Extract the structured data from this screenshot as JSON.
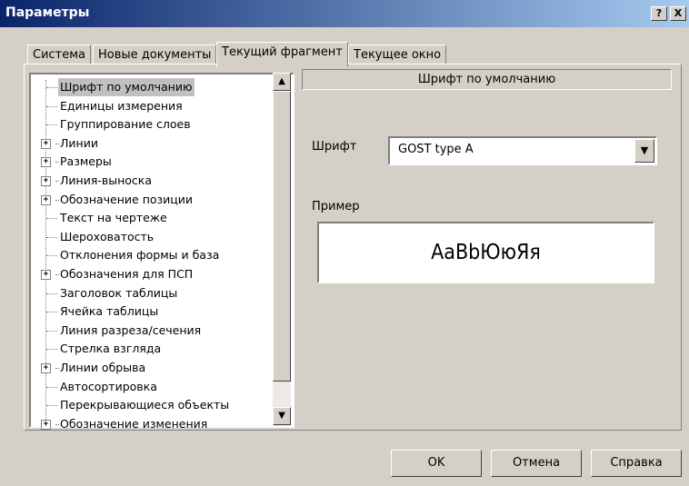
{
  "window": {
    "title": "Параметры"
  },
  "titlebar_buttons": {
    "help": "?",
    "close": "X"
  },
  "tabs": [
    {
      "label": "Система",
      "active": false
    },
    {
      "label": "Новые документы",
      "active": false
    },
    {
      "label": "Текущий фрагмент",
      "active": true
    },
    {
      "label": "Текущее окно",
      "active": false
    }
  ],
  "tree": {
    "items": [
      {
        "label": "Шрифт по умолчанию",
        "expandable": false,
        "selected": true
      },
      {
        "label": "Единицы измерения",
        "expandable": false,
        "selected": false
      },
      {
        "label": "Группирование слоев",
        "expandable": false,
        "selected": false
      },
      {
        "label": "Линии",
        "expandable": true,
        "selected": false
      },
      {
        "label": "Размеры",
        "expandable": true,
        "selected": false
      },
      {
        "label": "Линия-выноска",
        "expandable": true,
        "selected": false
      },
      {
        "label": "Обозначение позиции",
        "expandable": true,
        "selected": false
      },
      {
        "label": "Текст на чертеже",
        "expandable": false,
        "selected": false
      },
      {
        "label": "Шероховатость",
        "expandable": false,
        "selected": false
      },
      {
        "label": "Отклонения формы и база",
        "expandable": false,
        "selected": false
      },
      {
        "label": "Обозначения для ПСП",
        "expandable": true,
        "selected": false
      },
      {
        "label": "Заголовок таблицы",
        "expandable": false,
        "selected": false
      },
      {
        "label": "Ячейка таблицы",
        "expandable": false,
        "selected": false
      },
      {
        "label": "Линия разреза/сечения",
        "expandable": false,
        "selected": false
      },
      {
        "label": "Стрелка взгляда",
        "expandable": false,
        "selected": false
      },
      {
        "label": "Линии обрыва",
        "expandable": true,
        "selected": false
      },
      {
        "label": "Автосортировка",
        "expandable": false,
        "selected": false
      },
      {
        "label": "Перекрывающиеся объекты",
        "expandable": false,
        "selected": false
      },
      {
        "label": "Обозначение изменения",
        "expandable": true,
        "selected": false
      }
    ]
  },
  "panel": {
    "header": "Шрифт по умолчанию",
    "font_label": "Шрифт",
    "font_value": "GOST type A",
    "sample_label": "Пример",
    "sample_text": "АаВbЮюЯя"
  },
  "buttons": {
    "ok": "OK",
    "cancel": "Отмена",
    "help": "Справка"
  },
  "colors": {
    "titlebar_start": "#0a246a",
    "titlebar_end": "#a6caf0",
    "face": "#d4d0c8",
    "selection": "#c0c0c0"
  }
}
